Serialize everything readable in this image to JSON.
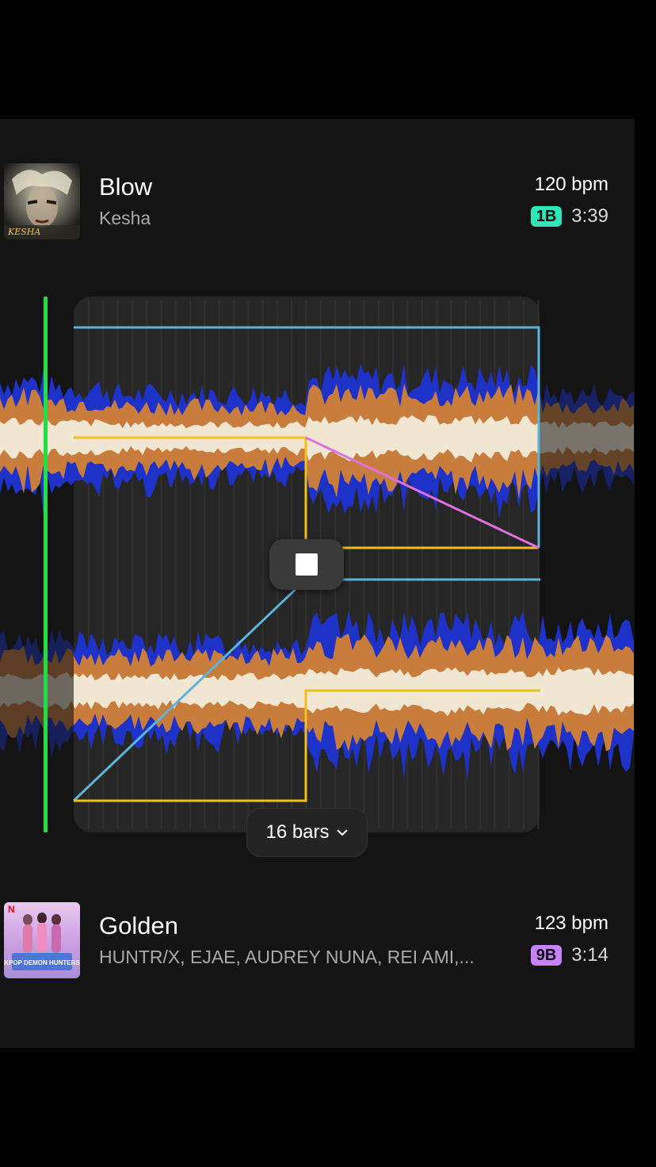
{
  "tracks": [
    {
      "title": "Blow",
      "artist": "Kesha",
      "bpm": "120 bpm",
      "key": "1B",
      "key_color": "#2ee6b8",
      "duration": "3:39",
      "art_text": "KESHA"
    },
    {
      "title": "Golden",
      "artist": "HUNTR/X, EJAE, AUDREY NUNA, REI AMI,...",
      "bpm": "123 bpm",
      "key": "9B",
      "key_color": "#c782ff",
      "duration": "3:14",
      "art_badge": "N",
      "art_text": "KPOP DEMON HUNTERS"
    }
  ],
  "mix": {
    "bars_label": "16 bars",
    "colors": {
      "playhead": "#22dd44",
      "transition_region": "#262626",
      "volume_curve": "#5ab4dc",
      "eq_curve": "#f0c020",
      "filter_curve": "#e070e0",
      "wave_low": "#1e32c8",
      "wave_mid": "#c87d3c",
      "wave_high": "#f0e6d2"
    }
  },
  "icons": [
    "stop-icon",
    "chevron-down-icon"
  ]
}
